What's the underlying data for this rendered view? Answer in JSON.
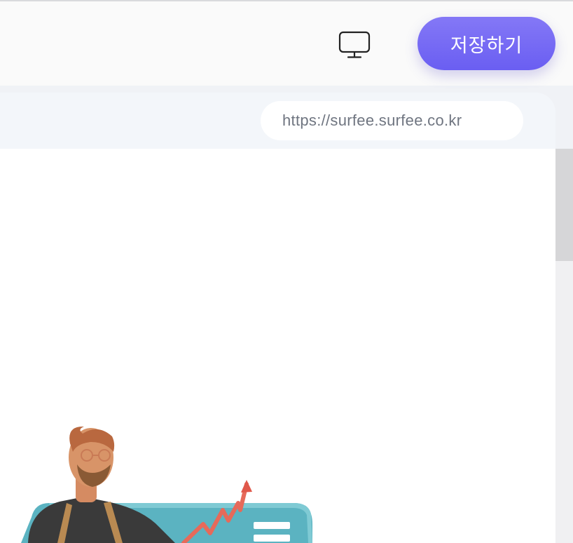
{
  "header": {
    "device_preview_icon": "monitor-icon",
    "save_label": "저장하기"
  },
  "browser": {
    "url": "https://surfee.surfee.co.kr"
  },
  "colors": {
    "accent": "#6a5ef2",
    "header_bg": "#fafafa",
    "bar_bg": "#f3f6fa"
  },
  "preview": {
    "illustration": "bearded-man-with-growth-chart-illustration"
  }
}
